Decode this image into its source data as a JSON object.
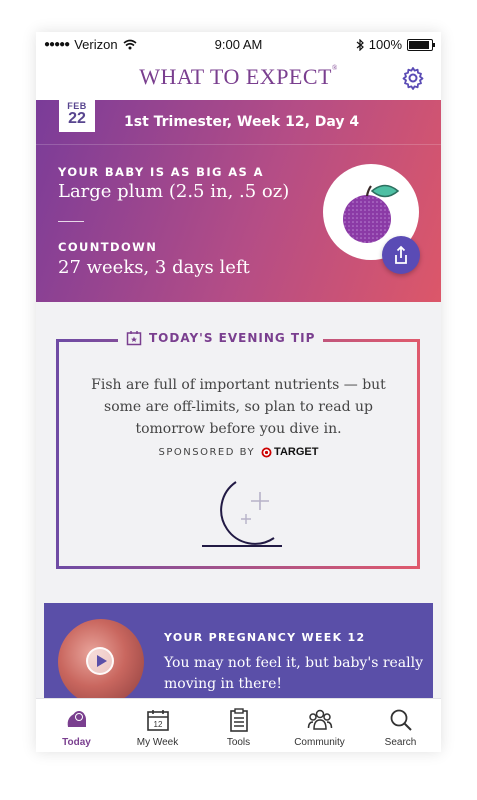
{
  "status_bar": {
    "carrier": "Verizon",
    "time": "9:00 AM",
    "battery": "100%"
  },
  "app_bar": {
    "logo": "WHAT TO EXPECT",
    "trademark": "®"
  },
  "hero": {
    "date_month": "FEB",
    "date_day": "22",
    "trimester_label": "1st Trimester, Week 12, Day 4",
    "size_label": "YOUR BABY IS AS BIG AS A",
    "size_value": "Large plum (2.5 in, .5 oz)",
    "countdown_label": "COUNTDOWN",
    "countdown_value": "27 weeks, 3 days left"
  },
  "tip": {
    "header": "TODAY'S EVENING TIP",
    "text": "Fish are full of important nutrients — but some are off-limits, so plan to read up tomorrow before you dive in.",
    "sponsored_by": "SPONSORED BY",
    "sponsor": "TARGET"
  },
  "week_card": {
    "label": "YOUR PREGNANCY WEEK 12",
    "text": "You may not feel it, but baby's really moving in there!"
  },
  "tabs": [
    {
      "label": "Today"
    },
    {
      "label": "My Week",
      "icon_number": "12"
    },
    {
      "label": "Tools"
    },
    {
      "label": "Community"
    },
    {
      "label": "Search"
    }
  ],
  "colors": {
    "brand_purple": "#7a3f8f",
    "accent_indigo": "#5a4fa8",
    "gradient_end": "#dc5769"
  }
}
